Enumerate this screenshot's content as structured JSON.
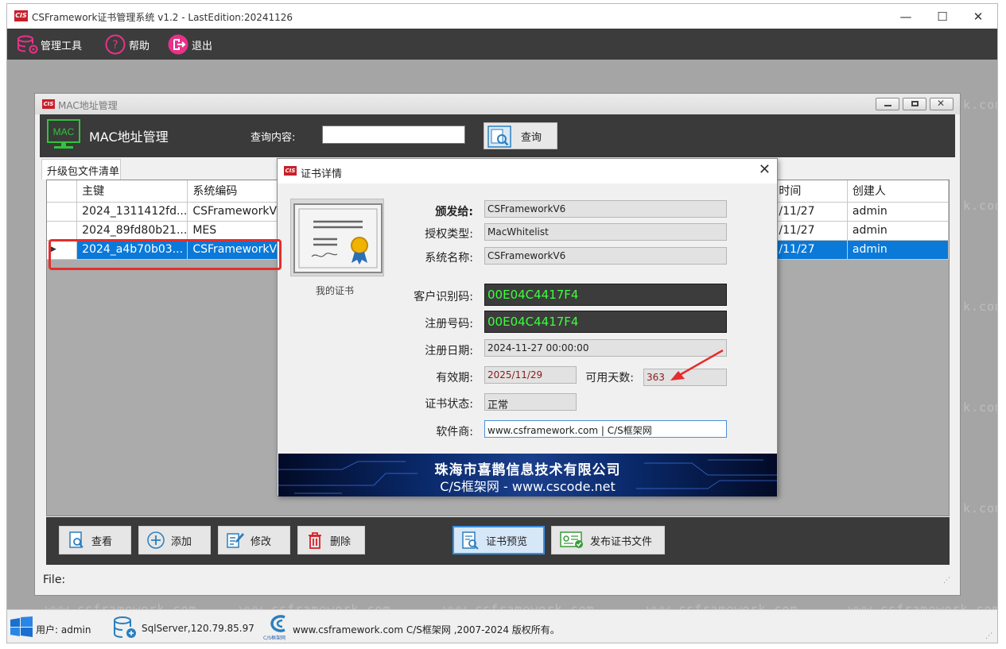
{
  "window": {
    "title": "CSFramework证书管理系统 v1.2 - LastEdition:20241126",
    "logo": "CIS"
  },
  "toolbar": {
    "tools": "管理工具",
    "help": "帮助",
    "exit": "退出"
  },
  "watermark": "www.csframework.com",
  "watermark_side": "k.com",
  "mdi": {
    "title": "MAC地址管理",
    "logo_text": "MAC",
    "header_title": "MAC地址管理",
    "query_label": "查询内容:",
    "query_value": "",
    "query_button": "查询",
    "tab": "升级包文件清单",
    "columns": [
      "主键",
      "系统编码",
      "时间",
      "创建人"
    ],
    "rows": [
      {
        "key": "2024_1311412fd...",
        "code": "CSFrameworkV6",
        "time": "/11/27",
        "creator": "admin"
      },
      {
        "key": "2024_89fd80b21...",
        "code": "MES",
        "time": "/11/27",
        "creator": "admin"
      },
      {
        "key": "2024_a4b70b03...",
        "code": "CSFrameworkV6",
        "time": "/11/27",
        "creator": "admin"
      }
    ],
    "buttons": {
      "view": "查看",
      "add": "添加",
      "edit": "修改",
      "delete": "删除",
      "preview": "证书预览",
      "publish": "发布证书文件"
    },
    "file_label": "File:"
  },
  "dialog": {
    "title": "证书详情",
    "caption": "我的证书",
    "labels": {
      "issued_to": "颁发给:",
      "license_type": "授权类型:",
      "system_name": "系统名称:",
      "client_id": "客户识别码:",
      "reg_no": "注册号码:",
      "reg_date": "注册日期:",
      "expiry": "有效期:",
      "days_left": "可用天数:",
      "status": "证书状态:",
      "vendor": "软件商:"
    },
    "values": {
      "issued_to": "CSFrameworkV6",
      "license_type": "MacWhitelist",
      "system_name": "CSFrameworkV6",
      "client_id": "00E04C4417F4",
      "reg_no": "00E04C4417F4",
      "reg_date": "2024-11-27 00:00:00",
      "expiry": "2025/11/29",
      "days_left": "363",
      "status": "正常",
      "vendor": "www.csframework.com | C/S框架网"
    },
    "banner": {
      "line1": "珠海市喜鹊信息技术有限公司",
      "line2": "C/S框架网 - www.cscode.net"
    }
  },
  "status": {
    "user": "用户: admin",
    "db": "SqlServer,120.79.85.97",
    "copyright": "www.csframework.com C/S框架网 ,2007-2024 版权所有。",
    "logo_caption": "C/S框架网"
  },
  "colors": {
    "toolbar": "#3c3c3c",
    "selection": "#0a79d8",
    "highlight": "#e52d2d",
    "green_text": "#3dff3d"
  }
}
